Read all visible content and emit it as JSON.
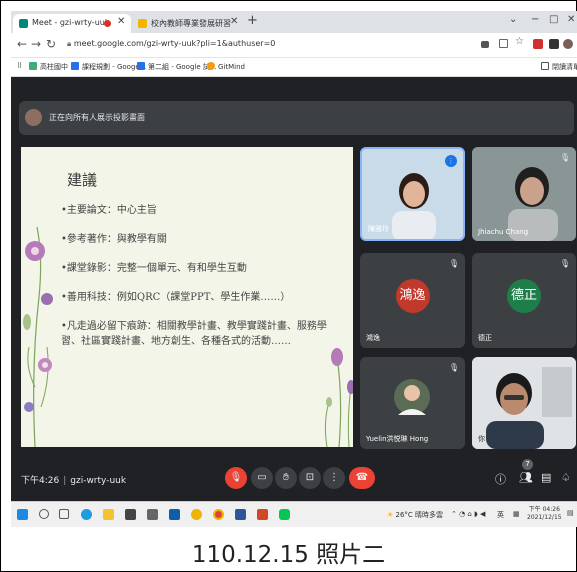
{
  "browser": {
    "tab_active_title": "Meet - gzi-wrty-uuk",
    "tab_inactive_title": "校內教師專業發展研習",
    "url": "meet.google.com/gzi-wrty-uuk?pli=1&authuser=0",
    "bookmarks": [
      {
        "label": "高柱國中",
        "color": "#4a7"
      },
      {
        "label": "課程規劃 - Googe...",
        "color": "#2a6ee8"
      },
      {
        "label": "第二組 - Google 試...",
        "color": "#2a6ee8"
      },
      {
        "label": "GitMind",
        "color": "#f39c12"
      }
    ],
    "reading_list": "閉讀清單",
    "colors": {
      "tabbar": "#dee1e6",
      "meet_bg": "#202124",
      "hangup": "#ea4335"
    }
  },
  "meet": {
    "presenting_banner": "正在向所有人展示投影畫面",
    "slide": {
      "title": "建議",
      "bullets": [
        "•主要論文：中心主旨",
        "•參考著作：與教學有關",
        "•課堂錄影：完整一個單元、有和學生互動",
        "•善用科技：例如QRC（課堂PPT、學生作業……）",
        "•凡走過必留下痕跡：相關教學計畫、教學實踐計畫、服務學習、社區實踐計畫、地方創生、各種各式的活動……"
      ]
    },
    "participants": [
      {
        "name": "陳雅玲",
        "type": "video"
      },
      {
        "name": "Jhiachu Chang",
        "type": "video"
      },
      {
        "name": "鴻逸",
        "type": "avatar",
        "letter": "鴻逸",
        "color": "#c0392b"
      },
      {
        "name": "德正",
        "type": "avatar",
        "letter": "德正",
        "color": "#1e7e4a"
      },
      {
        "name": "Yuelin洪悦琳 Hong",
        "type": "photo"
      },
      {
        "name": "你",
        "type": "video"
      }
    ],
    "time": "下午4:26",
    "meeting_code": "gzi-wrty-uuk",
    "participant_count": "7"
  },
  "taskbar": {
    "weather": "26°C 晴時多雲",
    "lang": "英",
    "clock_time": "下午 04:26",
    "clock_date": "2021/12/15"
  },
  "caption": "110.12.15 照片二"
}
